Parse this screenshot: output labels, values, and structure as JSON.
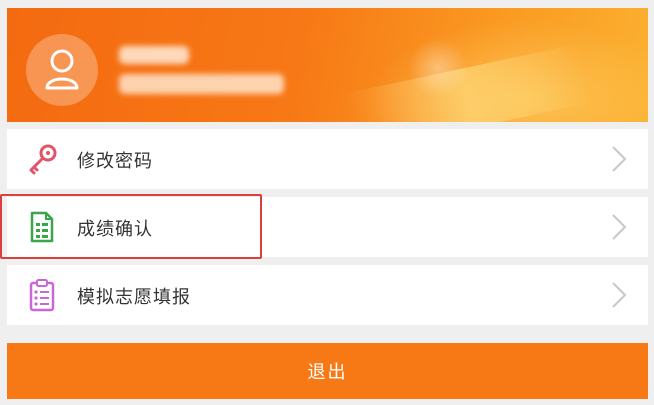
{
  "colors": {
    "accent": "#f77916",
    "header_start": "#f46a10",
    "header_end": "#fbb030",
    "highlight": "#d9403a",
    "text": "#333333"
  },
  "header": {
    "avatar_icon": "user-icon"
  },
  "menu": {
    "items": [
      {
        "label": "修改密码",
        "icon": "key-icon"
      },
      {
        "label": "成绩确认",
        "icon": "score-sheet-icon"
      },
      {
        "label": "模拟志愿填报",
        "icon": "clipboard-list-icon"
      }
    ]
  },
  "logout": {
    "label": "退出"
  }
}
